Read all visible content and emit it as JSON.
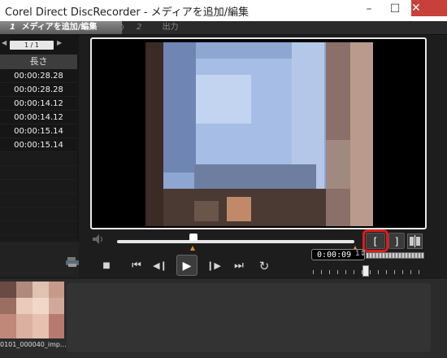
{
  "window": {
    "title": "Corel Direct DiscRecorder - メディアを追加/編集",
    "min_glyph": "–",
    "max_glyph": "☐",
    "close_glyph": "✕"
  },
  "steps": {
    "step1_num": "1",
    "step1_label": "メディアを追加/編集",
    "chevron": "〉",
    "step2_num": "2",
    "step2_label": "出力"
  },
  "clips": {
    "pager": "1 / 1",
    "column_header": "長さ",
    "durations": [
      "00:00:28.28",
      "00:00:28.28",
      "00:00:14.12",
      "00:00:14.12",
      "00:00:15.14",
      "00:00:15.14"
    ]
  },
  "player": {
    "timecode": "0:00:09",
    "timecode_unit_glyph": "1⇕",
    "mark_in_label": "[",
    "mark_out_label": "]",
    "transport": {
      "stop": "■",
      "to_start": "⏮",
      "prev_frame": "◀❙",
      "play": "▶",
      "next_frame": "❙▶",
      "to_end": "⏭",
      "repeat": "↻"
    }
  },
  "tray": {
    "clip_label": "0101_000040_imp..."
  },
  "colors": {
    "accent_red": "#e01b1b",
    "mark_orange": "#e8871f"
  }
}
